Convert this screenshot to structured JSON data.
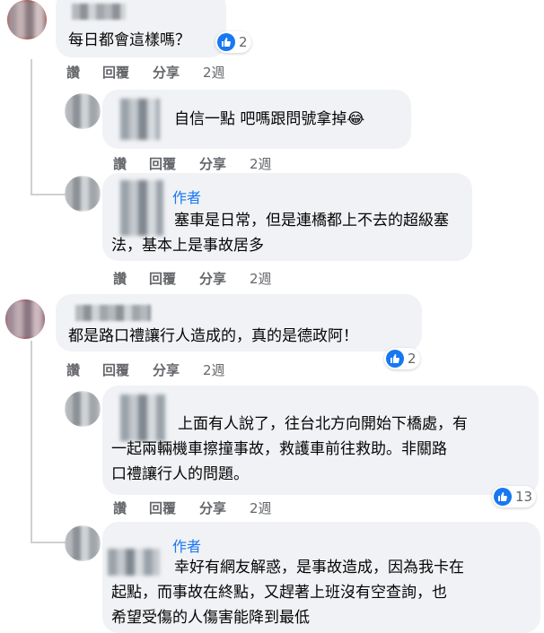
{
  "comments": [
    {
      "text": "每日都會這樣嗎？",
      "likes": "2",
      "actions": {
        "like": "讚",
        "reply": "回覆",
        "share": "分享",
        "time": "2週"
      },
      "replies": [
        {
          "text": "自信一點 吧嗎跟問號拿掉😂",
          "actions": {
            "like": "讚",
            "reply": "回覆",
            "share": "分享",
            "time": "2週"
          }
        },
        {
          "author_badge": "作者",
          "text_lines": [
            "塞車是日常，但是連橋都上不去的超級塞",
            "法，基本上是事故居多"
          ],
          "actions": {
            "like": "讚",
            "reply": "回覆",
            "share": "分享",
            "time": "2週"
          }
        }
      ]
    },
    {
      "text": "都是路口禮讓行人造成的，真的是德政阿！",
      "likes": "2",
      "actions": {
        "like": "讚",
        "reply": "回覆",
        "share": "分享",
        "time": "2週"
      },
      "replies": [
        {
          "text_lines": [
            "上面有人說了，往台北方向開始下橋處，有",
            "一起兩輛機車擦撞事故，救護車前往救助。非關路",
            "口禮讓行人的問題。"
          ],
          "likes": "13",
          "actions": {
            "like": "讚",
            "reply": "回覆",
            "share": "分享",
            "time": "2週"
          }
        },
        {
          "author_badge": "作者",
          "text_lines": [
            "幸好有網友解惑，是事故造成，因為我卡在",
            "起點，而事故在終點，又趕著上班沒有空查詢，也",
            "希望受傷的人傷害能降到最低"
          ]
        }
      ]
    }
  ],
  "colors": {
    "bubble": "#f0f2f5",
    "link_blue": "#1877f2",
    "meta_gray": "#65676b",
    "thread_line": "#ced0d4"
  },
  "icons": {
    "like": "thumbs-up-icon"
  }
}
